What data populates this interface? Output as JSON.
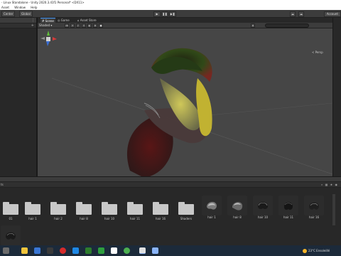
{
  "window": {
    "title": "- Linux Standalone - Unity 2020.3.41f1 Personal* <DX11>"
  },
  "menu": [
    "Asset",
    "Window",
    "Help"
  ],
  "toolbar": {
    "tabs": [
      "Center",
      "Global"
    ],
    "account_label": "Account"
  },
  "scene_view": {
    "tabs": [
      "Scene",
      "Game",
      "Asset Store"
    ],
    "shading_mode": "Shaded",
    "camera_mode": "2D",
    "perspective_label": "< Persp"
  },
  "project": {
    "left_label": "ts",
    "icons": [
      "search-icon",
      "filter-icon",
      "star-icon",
      "eye-icon"
    ],
    "assets": [
      {
        "label": "01",
        "kind": "folder"
      },
      {
        "label": "hair 1",
        "kind": "folder"
      },
      {
        "label": "hair 2",
        "kind": "folder"
      },
      {
        "label": "hair 8",
        "kind": "folder"
      },
      {
        "label": "hair 10",
        "kind": "folder"
      },
      {
        "label": "hair 11",
        "kind": "folder"
      },
      {
        "label": "hair 16",
        "kind": "folder"
      },
      {
        "label": "Shaders",
        "kind": "folder"
      },
      {
        "label": "hair 1",
        "kind": "model"
      },
      {
        "label": "hair 8",
        "kind": "model"
      },
      {
        "label": "hair 10",
        "kind": "model"
      },
      {
        "label": "hair 11",
        "kind": "model"
      },
      {
        "label": "hair 16",
        "kind": "model"
      },
      {
        "label": "",
        "kind": "model"
      }
    ]
  },
  "taskbar": {
    "apps": [
      "explorer-icon",
      "mail-icon",
      "opera-icon",
      "edge-icon",
      "store-icon",
      "photos-icon",
      "spreadsheet-icon",
      "unity-icon",
      "game-icon",
      "settings-icon",
      "chrome-icon"
    ],
    "weather": {
      "temp": "23°C",
      "desc": "Ensoleillé"
    }
  }
}
